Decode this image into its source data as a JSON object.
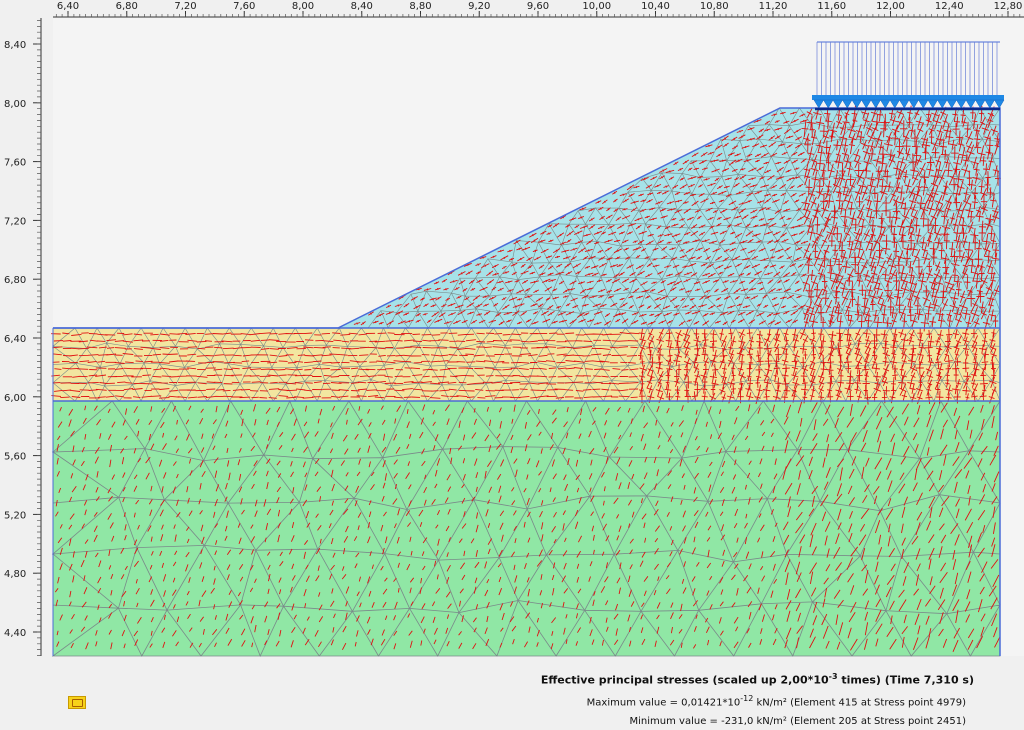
{
  "axes": {
    "x_ticks": [
      "6,40",
      "6,80",
      "7,20",
      "7,60",
      "8,00",
      "8,40",
      "8,80",
      "9,20",
      "9,60",
      "10,00",
      "10,40",
      "10,80",
      "11,20",
      "11,60",
      "12,00",
      "12,40",
      "12,80"
    ],
    "y_ticks": [
      "8,40",
      "8,00",
      "7,60",
      "7,20",
      "6,80",
      "6,40",
      "6,00",
      "5,60",
      "5,20",
      "4,80",
      "4,40"
    ]
  },
  "layers": [
    {
      "name": "embankment",
      "color": "#a6e2e8"
    },
    {
      "name": "upper-soil",
      "color": "#f2e6a0"
    },
    {
      "name": "lower-soil",
      "color": "#90e7a5"
    }
  ],
  "mesh_color": "#7a8a8a",
  "stress_color": "#e01010",
  "boundary_color": "#4a6bd8",
  "load_color": "#1e88e5",
  "caption": {
    "title_pre": "Effective principal stresses (scaled up 2,00*10",
    "title_exp": "-3",
    "title_post": " times) (Time 7,310 s)",
    "max_pre": "Maximum value = 0,01421*10",
    "max_exp": "-12",
    "max_post": " kN/m² (Element 415 at Stress point 4979)",
    "min_text": "Minimum value = -231,0 kN/m² (Element 205 at Stress point 2451)"
  },
  "icons": {
    "legend": "legend-icon"
  }
}
